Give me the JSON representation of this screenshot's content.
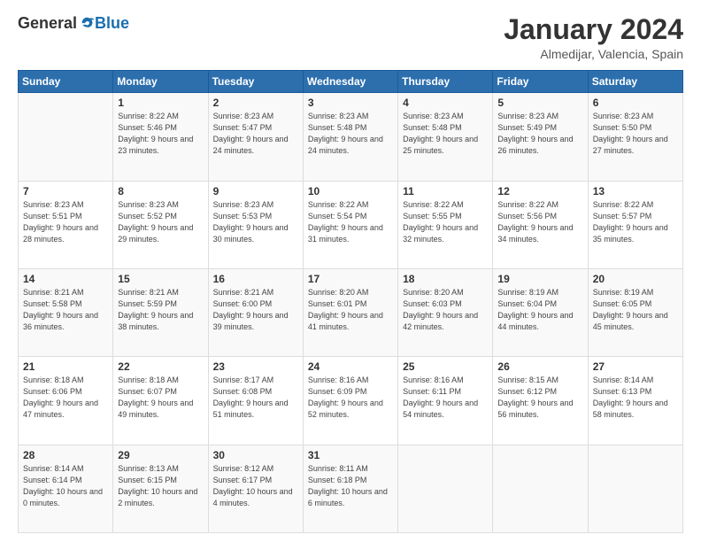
{
  "header": {
    "logo": {
      "general": "General",
      "blue": "Blue"
    },
    "title": "January 2024",
    "location": "Almedijar, Valencia, Spain"
  },
  "weekdays": [
    "Sunday",
    "Monday",
    "Tuesday",
    "Wednesday",
    "Thursday",
    "Friday",
    "Saturday"
  ],
  "weeks": [
    [
      {
        "day": "",
        "sunrise": "",
        "sunset": "",
        "daylight": ""
      },
      {
        "day": "1",
        "sunrise": "Sunrise: 8:22 AM",
        "sunset": "Sunset: 5:46 PM",
        "daylight": "Daylight: 9 hours and 23 minutes."
      },
      {
        "day": "2",
        "sunrise": "Sunrise: 8:23 AM",
        "sunset": "Sunset: 5:47 PM",
        "daylight": "Daylight: 9 hours and 24 minutes."
      },
      {
        "day": "3",
        "sunrise": "Sunrise: 8:23 AM",
        "sunset": "Sunset: 5:48 PM",
        "daylight": "Daylight: 9 hours and 24 minutes."
      },
      {
        "day": "4",
        "sunrise": "Sunrise: 8:23 AM",
        "sunset": "Sunset: 5:48 PM",
        "daylight": "Daylight: 9 hours and 25 minutes."
      },
      {
        "day": "5",
        "sunrise": "Sunrise: 8:23 AM",
        "sunset": "Sunset: 5:49 PM",
        "daylight": "Daylight: 9 hours and 26 minutes."
      },
      {
        "day": "6",
        "sunrise": "Sunrise: 8:23 AM",
        "sunset": "Sunset: 5:50 PM",
        "daylight": "Daylight: 9 hours and 27 minutes."
      }
    ],
    [
      {
        "day": "7",
        "sunrise": "Sunrise: 8:23 AM",
        "sunset": "Sunset: 5:51 PM",
        "daylight": "Daylight: 9 hours and 28 minutes."
      },
      {
        "day": "8",
        "sunrise": "Sunrise: 8:23 AM",
        "sunset": "Sunset: 5:52 PM",
        "daylight": "Daylight: 9 hours and 29 minutes."
      },
      {
        "day": "9",
        "sunrise": "Sunrise: 8:23 AM",
        "sunset": "Sunset: 5:53 PM",
        "daylight": "Daylight: 9 hours and 30 minutes."
      },
      {
        "day": "10",
        "sunrise": "Sunrise: 8:22 AM",
        "sunset": "Sunset: 5:54 PM",
        "daylight": "Daylight: 9 hours and 31 minutes."
      },
      {
        "day": "11",
        "sunrise": "Sunrise: 8:22 AM",
        "sunset": "Sunset: 5:55 PM",
        "daylight": "Daylight: 9 hours and 32 minutes."
      },
      {
        "day": "12",
        "sunrise": "Sunrise: 8:22 AM",
        "sunset": "Sunset: 5:56 PM",
        "daylight": "Daylight: 9 hours and 34 minutes."
      },
      {
        "day": "13",
        "sunrise": "Sunrise: 8:22 AM",
        "sunset": "Sunset: 5:57 PM",
        "daylight": "Daylight: 9 hours and 35 minutes."
      }
    ],
    [
      {
        "day": "14",
        "sunrise": "Sunrise: 8:21 AM",
        "sunset": "Sunset: 5:58 PM",
        "daylight": "Daylight: 9 hours and 36 minutes."
      },
      {
        "day": "15",
        "sunrise": "Sunrise: 8:21 AM",
        "sunset": "Sunset: 5:59 PM",
        "daylight": "Daylight: 9 hours and 38 minutes."
      },
      {
        "day": "16",
        "sunrise": "Sunrise: 8:21 AM",
        "sunset": "Sunset: 6:00 PM",
        "daylight": "Daylight: 9 hours and 39 minutes."
      },
      {
        "day": "17",
        "sunrise": "Sunrise: 8:20 AM",
        "sunset": "Sunset: 6:01 PM",
        "daylight": "Daylight: 9 hours and 41 minutes."
      },
      {
        "day": "18",
        "sunrise": "Sunrise: 8:20 AM",
        "sunset": "Sunset: 6:03 PM",
        "daylight": "Daylight: 9 hours and 42 minutes."
      },
      {
        "day": "19",
        "sunrise": "Sunrise: 8:19 AM",
        "sunset": "Sunset: 6:04 PM",
        "daylight": "Daylight: 9 hours and 44 minutes."
      },
      {
        "day": "20",
        "sunrise": "Sunrise: 8:19 AM",
        "sunset": "Sunset: 6:05 PM",
        "daylight": "Daylight: 9 hours and 45 minutes."
      }
    ],
    [
      {
        "day": "21",
        "sunrise": "Sunrise: 8:18 AM",
        "sunset": "Sunset: 6:06 PM",
        "daylight": "Daylight: 9 hours and 47 minutes."
      },
      {
        "day": "22",
        "sunrise": "Sunrise: 8:18 AM",
        "sunset": "Sunset: 6:07 PM",
        "daylight": "Daylight: 9 hours and 49 minutes."
      },
      {
        "day": "23",
        "sunrise": "Sunrise: 8:17 AM",
        "sunset": "Sunset: 6:08 PM",
        "daylight": "Daylight: 9 hours and 51 minutes."
      },
      {
        "day": "24",
        "sunrise": "Sunrise: 8:16 AM",
        "sunset": "Sunset: 6:09 PM",
        "daylight": "Daylight: 9 hours and 52 minutes."
      },
      {
        "day": "25",
        "sunrise": "Sunrise: 8:16 AM",
        "sunset": "Sunset: 6:11 PM",
        "daylight": "Daylight: 9 hours and 54 minutes."
      },
      {
        "day": "26",
        "sunrise": "Sunrise: 8:15 AM",
        "sunset": "Sunset: 6:12 PM",
        "daylight": "Daylight: 9 hours and 56 minutes."
      },
      {
        "day": "27",
        "sunrise": "Sunrise: 8:14 AM",
        "sunset": "Sunset: 6:13 PM",
        "daylight": "Daylight: 9 hours and 58 minutes."
      }
    ],
    [
      {
        "day": "28",
        "sunrise": "Sunrise: 8:14 AM",
        "sunset": "Sunset: 6:14 PM",
        "daylight": "Daylight: 10 hours and 0 minutes."
      },
      {
        "day": "29",
        "sunrise": "Sunrise: 8:13 AM",
        "sunset": "Sunset: 6:15 PM",
        "daylight": "Daylight: 10 hours and 2 minutes."
      },
      {
        "day": "30",
        "sunrise": "Sunrise: 8:12 AM",
        "sunset": "Sunset: 6:17 PM",
        "daylight": "Daylight: 10 hours and 4 minutes."
      },
      {
        "day": "31",
        "sunrise": "Sunrise: 8:11 AM",
        "sunset": "Sunset: 6:18 PM",
        "daylight": "Daylight: 10 hours and 6 minutes."
      },
      {
        "day": "",
        "sunrise": "",
        "sunset": "",
        "daylight": ""
      },
      {
        "day": "",
        "sunrise": "",
        "sunset": "",
        "daylight": ""
      },
      {
        "day": "",
        "sunrise": "",
        "sunset": "",
        "daylight": ""
      }
    ]
  ]
}
